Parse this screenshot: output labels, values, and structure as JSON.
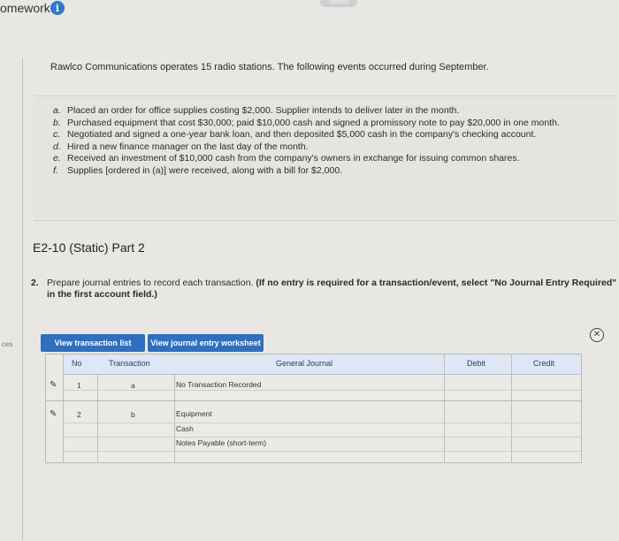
{
  "app": {
    "title": "omework",
    "info_icon": "i",
    "saved_label": "Saved",
    "corner_text": ""
  },
  "side_label": "ces",
  "intro": "Rawlco Communications operates 15 radio stations. The following events occurred during September.",
  "events": [
    {
      "letter": "a.",
      "text": "Placed an order for office supplies costing $2,000. Supplier intends to deliver later in the month."
    },
    {
      "letter": "b.",
      "text": "Purchased equipment that cost $30,000; paid $10,000 cash and signed a promissory note to pay $20,000 in one month."
    },
    {
      "letter": "c.",
      "text": "Negotiated and signed a one-year bank loan, and then deposited $5,000 cash in the company's checking account."
    },
    {
      "letter": "d.",
      "text": "Hired a new finance manager on the last day of the month."
    },
    {
      "letter": "e.",
      "text": "Received an investment of $10,000 cash from the company's owners in exchange for issuing common shares."
    },
    {
      "letter": "f.",
      "text": "Supplies [ordered in (a)] were received, along with a bill for $2,000."
    }
  ],
  "part_title": "E2-10 (Static) Part 2",
  "instruction": {
    "number": "2.",
    "text": "Prepare journal entries to record each transaction. ",
    "bold_text": "(If no entry is required for a transaction/event, select \"No Journal Entry Required\" in the first account field.)"
  },
  "tabs": {
    "transaction_list": "View transaction list",
    "journal_worksheet": "View journal entry worksheet"
  },
  "journal": {
    "headers": {
      "no": "No",
      "transaction": "Transaction",
      "general_journal": "General Journal",
      "debit": "Debit",
      "credit": "Credit"
    },
    "rows": [
      {
        "no": "1",
        "transaction": "a",
        "accounts": [
          "No Transaction Recorded"
        ]
      },
      {
        "no": "2",
        "transaction": "b",
        "accounts": [
          "Equipment",
          "Cash",
          "Notes Payable (short-term)"
        ]
      }
    ]
  },
  "colors": {
    "accent": "#2f6fc0",
    "header_bg": "#dfe6f4"
  }
}
